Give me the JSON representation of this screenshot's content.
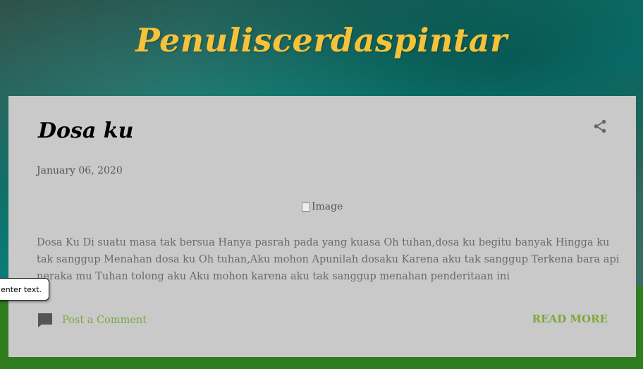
{
  "blog": {
    "title": "Penuliscerdaspintar"
  },
  "post": {
    "title": "Dosa ku",
    "date": "January 06, 2020",
    "image_alt": "Image",
    "body": "Dosa Ku Di suatu masa tak bersua Hanya pasrah pada yang kuasa Oh tuhan,dosa ku begitu banyak Hingga ku tak sanggup Menahan dosa ku Oh tuhan,Aku mohon Apunilah dosaku Karena aku tak sanggup Terkena bara api neraka mu Tuhan tolong aku Aku mohon  karena  aku tak sanggup menahan penderitaan ini",
    "comment_label": "Post a Comment",
    "read_more_label": "READ MORE",
    "share_icon": "share-icon"
  },
  "tooltip": {
    "text": "enter text."
  },
  "colors": {
    "title": "#f5c23a",
    "card": "#c9c9c9",
    "link": "#7da83a",
    "footer_green": "#2f7d1f"
  }
}
